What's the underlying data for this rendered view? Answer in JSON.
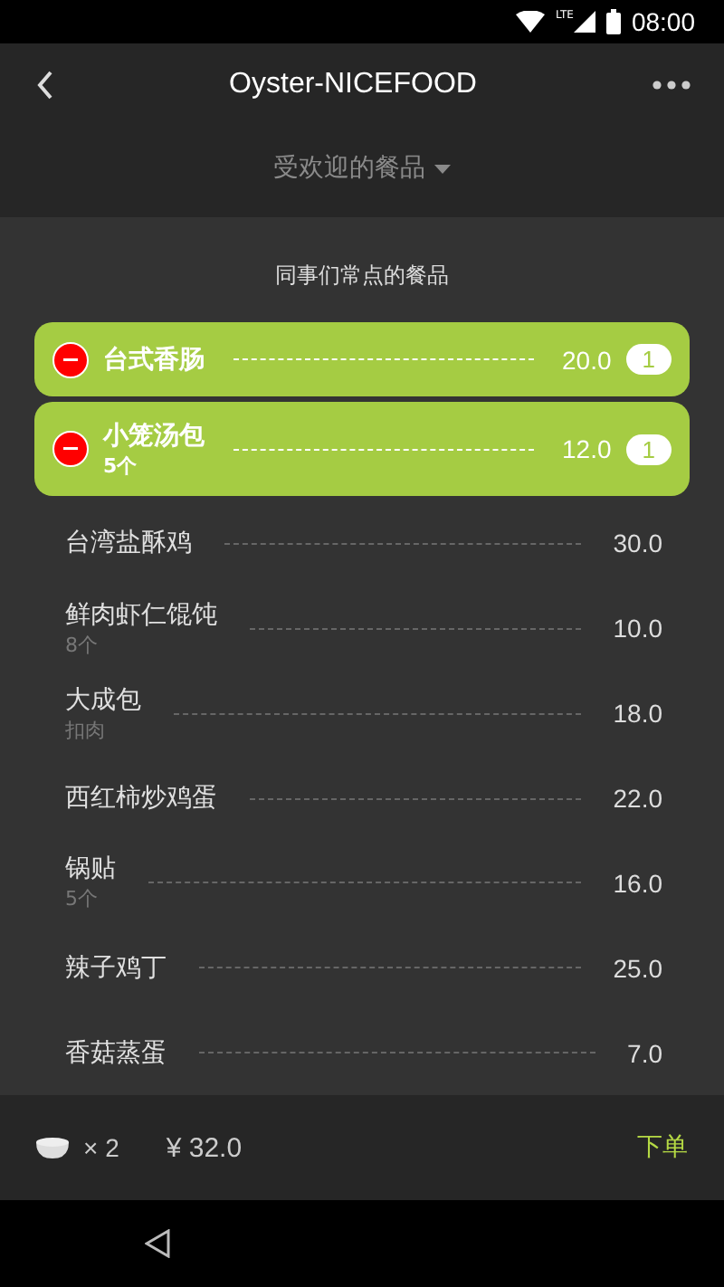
{
  "status_bar": {
    "time": "08:00",
    "network": "LTE"
  },
  "header": {
    "title": "Oyster-NICEFOOD",
    "filter": "受欢迎的餐品"
  },
  "section_title": "同事们常点的餐品",
  "dishes": [
    {
      "name": "台式香肠",
      "price": "20.0",
      "count": "1",
      "selected": true
    },
    {
      "name": "小笼汤包",
      "note": "5个",
      "price": "12.0",
      "count": "1",
      "selected": true
    },
    {
      "name": "台湾盐酥鸡",
      "price": "30.0",
      "selected": false
    },
    {
      "name": "鲜肉虾仁馄饨",
      "note": "8个",
      "price": "10.0",
      "selected": false
    },
    {
      "name": "大成包",
      "note": "扣肉",
      "price": "18.0",
      "selected": false
    },
    {
      "name": "西红柿炒鸡蛋",
      "price": "22.0",
      "selected": false
    },
    {
      "name": "锅贴",
      "note": "5个",
      "price": "16.0",
      "selected": false
    },
    {
      "name": "辣子鸡丁",
      "price": "25.0",
      "selected": false
    },
    {
      "name": "香菇蒸蛋",
      "price": "7.0",
      "selected": false
    }
  ],
  "cart": {
    "quantity": "× 2",
    "total": "¥ 32.0",
    "order_button": "下单"
  }
}
